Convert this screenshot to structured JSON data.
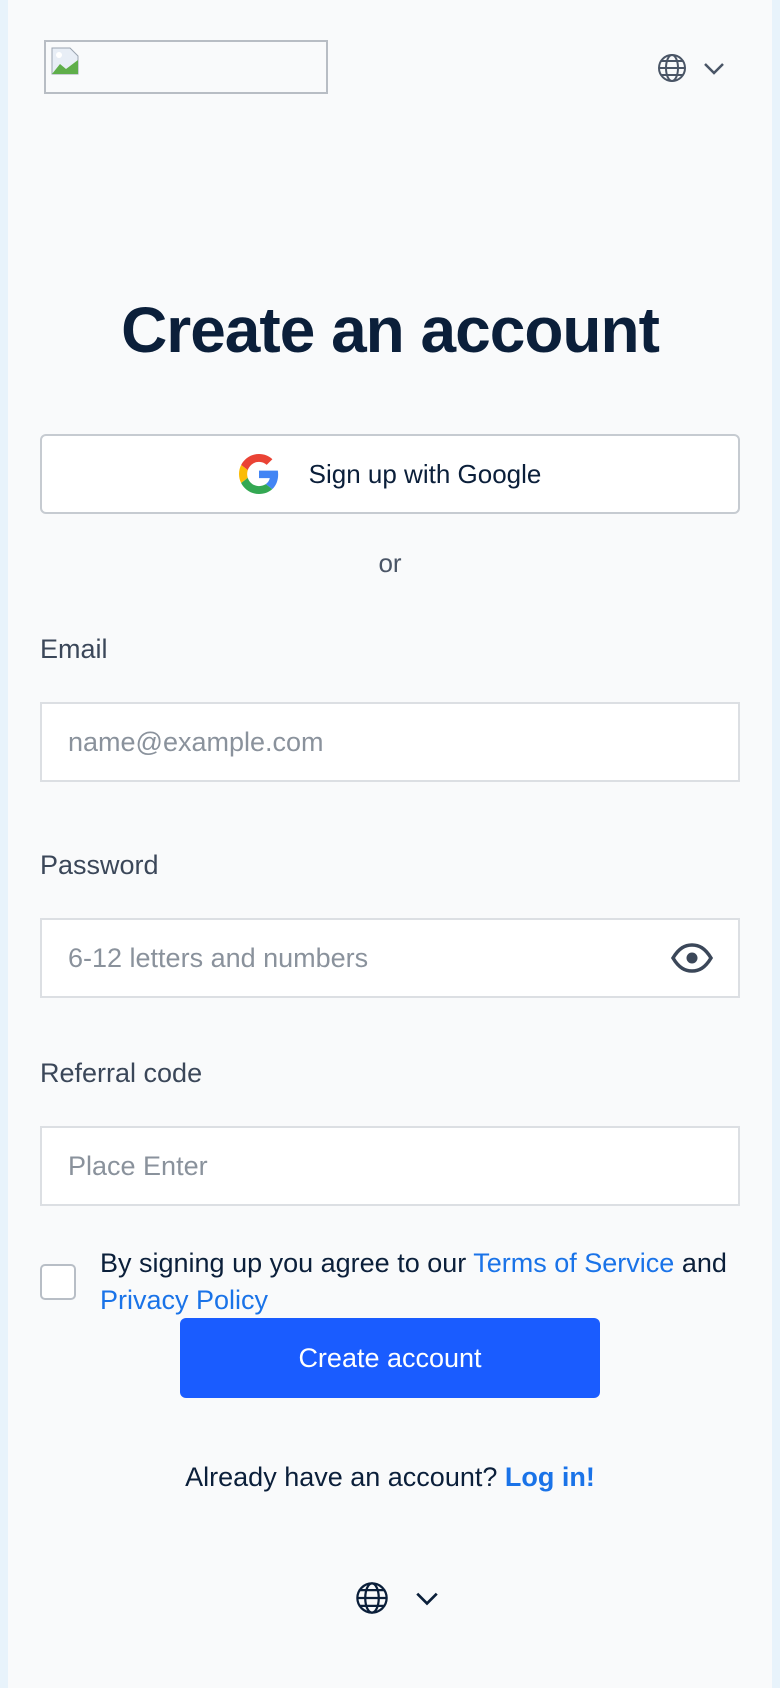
{
  "header": {
    "logo_alt": "",
    "language_icon": "globe-icon",
    "language_caret_icon": "chevron-down-icon"
  },
  "title": "Create an account",
  "google_button": {
    "label": "Sign up with Google",
    "icon": "google-icon"
  },
  "divider_text": "or",
  "form": {
    "email": {
      "label": "Email",
      "placeholder": "name@example.com",
      "value": ""
    },
    "password": {
      "label": "Password",
      "placeholder": "6-12 letters and numbers",
      "value": "",
      "toggle_icon": "eye-icon"
    },
    "referral": {
      "label": "Referral code",
      "placeholder": "Place Enter",
      "value": ""
    }
  },
  "agreement": {
    "checked": false,
    "prefix": "By signing up you agree to our ",
    "terms_label": "Terms of Service",
    "middle": " and",
    "privacy_label": "Privacy Policy"
  },
  "submit_label": "Create account",
  "login_prompt": {
    "text": "Already have an account? ",
    "link_label": "Log in!"
  },
  "footer": {
    "language_icon": "globe-icon",
    "language_caret_icon": "chevron-down-icon"
  },
  "colors": {
    "primary": "#1a5cff",
    "link": "#1a73e8",
    "heading": "#0b1f3a",
    "background": "#f9fafb",
    "side_background": "#e8f3fb"
  }
}
